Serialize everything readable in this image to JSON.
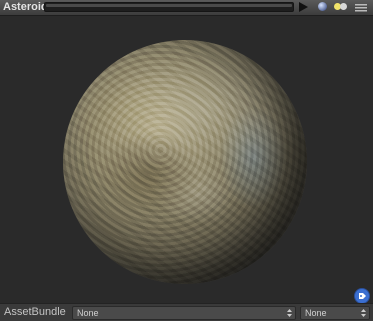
{
  "window": {
    "title": "Asteroid"
  },
  "toolbar": {
    "play_icon": "play-icon",
    "preview_shape_icon": "sphere-icon",
    "lighting_icon": "light-icon",
    "menu_icon": "options-icon"
  },
  "preview": {
    "object": "asteroid-sphere"
  },
  "footer": {
    "asset_bundle_label": "AssetBundle",
    "asset_bundle_value": "None",
    "variant_value": "None"
  }
}
